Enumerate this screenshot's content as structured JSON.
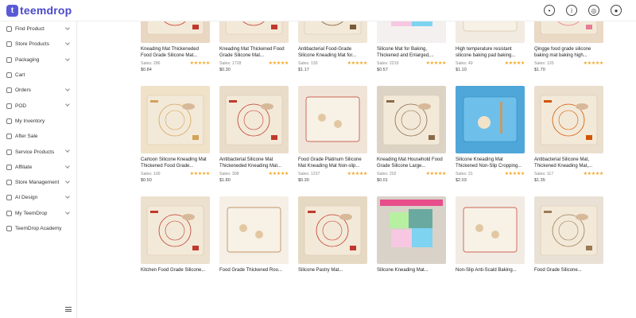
{
  "app": {
    "name": "teemdrop"
  },
  "topbar_icons": [
    "bell-icon",
    "info-icon",
    "globe-icon",
    "user-icon"
  ],
  "sidebar": {
    "items": [
      {
        "label": "Find Product",
        "chevron": true
      },
      {
        "label": "Store Products",
        "chevron": true
      },
      {
        "label": "Packaging",
        "chevron": true
      },
      {
        "label": "Cart",
        "chevron": false
      },
      {
        "label": "Orders",
        "chevron": true
      },
      {
        "label": "POD",
        "chevron": true
      },
      {
        "label": "My Inventory",
        "chevron": false
      },
      {
        "label": "After Sale",
        "chevron": false
      },
      {
        "label": "Service Products",
        "chevron": true
      },
      {
        "label": "Affiliate",
        "chevron": true
      },
      {
        "label": "Store Management",
        "chevron": true
      },
      {
        "label": "AI Design",
        "chevron": true
      },
      {
        "label": "My TeemDrop",
        "chevron": true
      },
      {
        "label": "TeemDrop Academy",
        "chevron": false
      }
    ]
  },
  "products": [
    {
      "title": "Kneading Mat Thickeneded Food Grade Silicone Mat...",
      "sales": "Sales: 286",
      "price": "$0.84",
      "bg": "#e9d7c2",
      "accent": "#c0392b",
      "type": "mat"
    },
    {
      "title": "Kneading Mat Thickened Food Grade Silicone Mat...",
      "sales": "Sales: 1728",
      "price": "$0.30",
      "bg": "#efe2d0",
      "accent": "#c0392b",
      "type": "mat"
    },
    {
      "title": "Antibacterial Food-Grade Silicone Kneading Mat for...",
      "sales": "Sales: 130",
      "price": "$1.17",
      "bg": "#efe6d6",
      "accent": "#7a5a3a",
      "type": "mat"
    },
    {
      "title": "Silicone Mat for Baking, Thickened and Enlarged,...",
      "sales": "Sales: 2219",
      "price": "$0.57",
      "bg": "#f4f0ef",
      "accent": "#e84393",
      "type": "colors"
    },
    {
      "title": "High temperature resistant silicone baking pad baking...",
      "sales": "Sales: 49",
      "price": "$1.10",
      "bg": "#f2ebe1",
      "accent": "#d8c6a6",
      "type": "plain"
    },
    {
      "title": "Qingge food grade silicone baking mat baking high...",
      "sales": "Sales: 120",
      "price": "$1.70",
      "bg": "#ead9c5",
      "accent": "#e57c95",
      "type": "mat"
    },
    {
      "title": "Cartoon Silicone Kneading Mat Thickened Food Grade...",
      "sales": "Sales: 100",
      "price": "$0.50",
      "bg": "#efe2c8",
      "accent": "#d4a259",
      "type": "mat"
    },
    {
      "title": "Antibacterial Silicone Mat Thickeneded Kneading Mat...",
      "sales": "Sales: 308",
      "price": "$1.80",
      "bg": "#e9dcc8",
      "accent": "#c0392b",
      "type": "mat"
    },
    {
      "title": "Food Grade Platinum Silicone Mat Kneading Mat Non-slip...",
      "sales": "Sales: 1237",
      "price": "$0.30",
      "bg": "#efe4d7",
      "accent": "#c0392b",
      "type": "plain"
    },
    {
      "title": "Kneading Mat Household Food Grade Silicone Large...",
      "sales": "Sales: 202",
      "price": "$0.01",
      "bg": "#ddd3c5",
      "accent": "#8a6a4a",
      "type": "mat"
    },
    {
      "title": "Silicone Kneading Mat Thickened Non-Slip Cropping...",
      "sales": "Sales: 31",
      "price": "$2.03",
      "bg": "#4fa6d8",
      "accent": "#2e86c1",
      "type": "blue"
    },
    {
      "title": "Antibacterial Silicone Mat, Thickened Kneading Mat,...",
      "sales": "Sales: 117",
      "price": "$1.35",
      "bg": "#eadfcd",
      "accent": "#d35400",
      "type": "mat"
    },
    {
      "title": "Kitchen Food Grade Silicone...",
      "sales": "",
      "price": "",
      "bg": "#ece0cf",
      "accent": "#c0392b",
      "type": "mat"
    },
    {
      "title": "Food Grade Thickened Roo...",
      "sales": "",
      "price": "",
      "bg": "#f5efe6",
      "accent": "#b07a3a",
      "type": "plain"
    },
    {
      "title": "Silicone Pastry Mat...",
      "sales": "",
      "price": "",
      "bg": "#e6d9c3",
      "accent": "#c0392b",
      "type": "mat"
    },
    {
      "title": "Silicone Kneading Mat...",
      "sales": "",
      "price": "",
      "bg": "#d8d2c8",
      "accent": "#6aa9a0",
      "type": "colors"
    },
    {
      "title": "Non-Slip Anti-Scald Baking...",
      "sales": "",
      "price": "",
      "bg": "#f2ebe3",
      "accent": "#c0392b",
      "type": "plain"
    },
    {
      "title": "Food Grade Silicone...",
      "sales": "",
      "price": "",
      "bg": "#e9e1d6",
      "accent": "#9c7b54",
      "type": "mat"
    }
  ],
  "rating": "★★★★★"
}
